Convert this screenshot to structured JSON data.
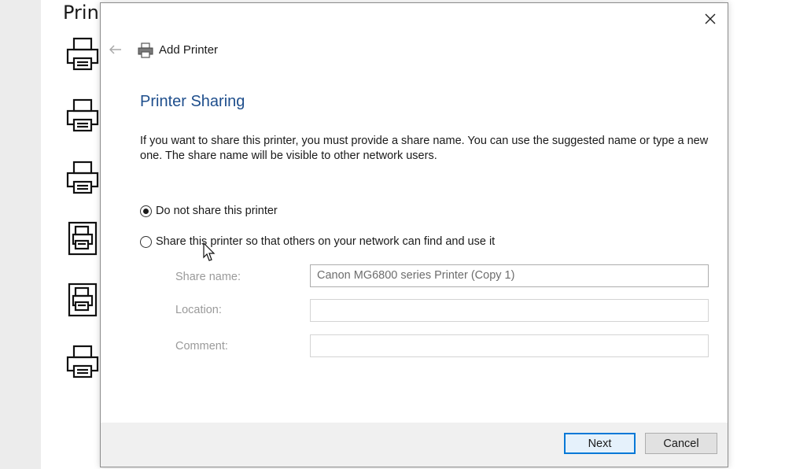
{
  "background_window": {
    "title": "Prin",
    "icons": [
      "printer-icon",
      "printer-icon",
      "printer-icon",
      "fax-icon",
      "fax-icon",
      "printer-icon"
    ]
  },
  "dialog": {
    "header_title": "Add Printer",
    "section_title": "Printer Sharing",
    "description": "If you want to share this printer, you must provide a share name. You can use the suggested name or type a new one. The share name will be visible to other network users.",
    "options": [
      {
        "label": "Do not share this printer",
        "selected": true
      },
      {
        "label": "Share this printer so that others on your network can find and use it",
        "selected": false
      }
    ],
    "fields": {
      "share_name": {
        "label": "Share name:",
        "value": "Canon MG6800 series Printer (Copy 1)",
        "enabled": false
      },
      "location": {
        "label": "Location:",
        "value": "",
        "enabled": false
      },
      "comment": {
        "label": "Comment:",
        "value": "",
        "enabled": false
      }
    },
    "buttons": {
      "next": "Next",
      "cancel": "Cancel"
    },
    "colors": {
      "section_title": "#1e4e8c",
      "primary_border": "#0078d7"
    }
  }
}
